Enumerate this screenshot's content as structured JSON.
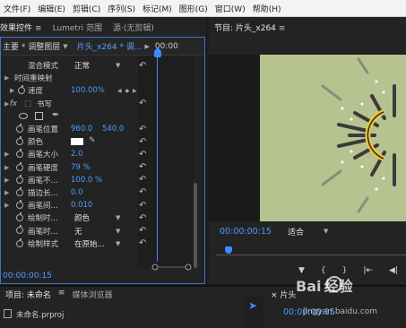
{
  "menubar": {
    "items": [
      "文件(F)",
      "编辑(E)",
      "剪辑(C)",
      "序列(S)",
      "标记(M)",
      "图形(G)",
      "窗口(W)",
      "帮助(H)"
    ]
  },
  "left_tabs": {
    "effect_controls": "效果控件",
    "lumetri": "Lumetri 范围",
    "source": "源·(无剪辑)"
  },
  "effect_controls": {
    "master_label": "主要 * 调整图层",
    "clip_label": "片头_x264 * 调...",
    "header_timecode": "00:00",
    "footer_timecode": "00:00:00:15",
    "rows": {
      "blend_mode_label": "混合模式",
      "blend_mode_value": "正常",
      "time_remap_label": "时间重映射",
      "speed_label": "速度",
      "speed_value": "100.00%",
      "write_label": "书写",
      "brush_pos_label": "画笔位置",
      "brush_pos_x": "960.0",
      "brush_pos_y": "540.0",
      "color_label": "颜色",
      "brush_size_label": "画笔大小",
      "brush_size_value": "2.0",
      "brush_hardness_label": "画笔硬度",
      "brush_hardness_value": "79 %",
      "brush_opacity_label": "画笔不...",
      "brush_opacity_value": "100.0 %",
      "stroke_length_label": "描边长...",
      "stroke_length_value": "0.0",
      "brush_spacing_label": "画笔间...",
      "brush_spacing_value": "0.010",
      "paint_time_label": "绘制时...",
      "paint_time_value": "颜色",
      "brush_time_label": "画笔时...",
      "brush_time_value": "无",
      "paint_style_label": "绘制样式",
      "paint_style_value": "在原始..."
    }
  },
  "program_monitor": {
    "title": "节目: 片头_x264",
    "timecode": "00:00:00:15",
    "fit": "适合",
    "canvas_color": "#b6c390"
  },
  "project": {
    "tab_active": "项目: 未命名",
    "tab_browser": "媒体浏览器",
    "file": "未命名.prproj"
  },
  "timeline": {
    "tab": "片头",
    "timecode": "00:00:00:15"
  },
  "watermark": {
    "text": "Bai 经验",
    "sub": "jingyan.baidu.com"
  },
  "colors": {
    "accent_blue": "#4d9bff",
    "panel_focus_border": "#3d74c5",
    "rays": "#3a3a3a",
    "arc_yellow": "#f2c53d"
  },
  "icons": [
    "stopwatch-icon",
    "reset-icon",
    "ellipse-tool-icon",
    "rectangle-tool-icon",
    "pen-tool-icon",
    "eyedropper-icon",
    "selection-tool-icon",
    "hamburger-menu-icon"
  ]
}
